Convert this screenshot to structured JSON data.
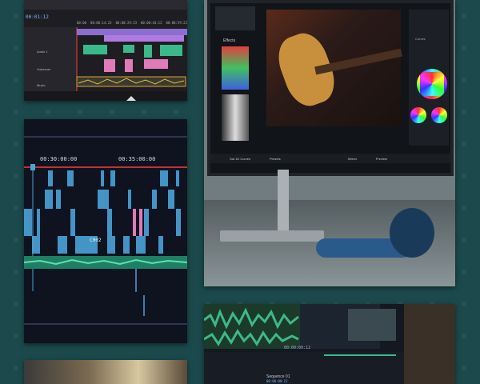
{
  "tile_top_left": {
    "timecode": "00:01:12",
    "ruler_marks": [
      "00:00",
      "00:00:14:23",
      "00:00:29:23",
      "00:00:44:12",
      "00:00:59:22"
    ],
    "track_labels": [
      "Audio 1",
      "Voiceover",
      "Music"
    ]
  },
  "tile_timeline": {
    "time_marks": [
      "00:30:00:00",
      "00:35:00:00"
    ],
    "clip_label": "C002"
  },
  "tile_monitor": {
    "panel_title": "Effects",
    "bottom_bar": [
      "Sat 1D Curves",
      "Presets",
      "Select",
      "Preview"
    ],
    "scopes_label": "Curves"
  },
  "tile_audio": {
    "timecode": "00:00:00:12",
    "sequence_label": "Sequence 01",
    "timecode_2": "00:00:00:12"
  },
  "colors": {
    "background": "#1c4a4c",
    "playhead": "#ff3b3b",
    "audio_green": "#3cb98a",
    "clip_blue": "#4aa3d8",
    "clip_purple": "#a07ad8",
    "clip_pink": "#e07ab8"
  }
}
